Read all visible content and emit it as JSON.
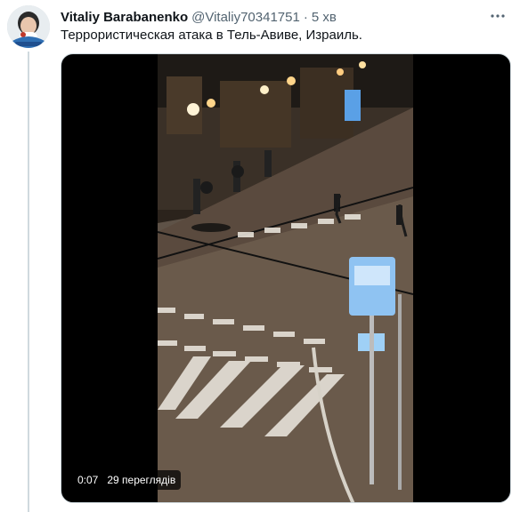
{
  "tweet": {
    "author_name": "Vitaliy Barabanenko",
    "handle": "@Vitaliy70341751",
    "separator": "·",
    "time": "5 хв",
    "text": "Террористическая атака в Тель-Авиве, Израиль.",
    "more_icon": "more-horizontal-icon"
  },
  "video": {
    "elapsed": "0:07",
    "views": "29 переглядів"
  },
  "colors": {
    "accent": "#1d9bf0",
    "text": "#0f1419",
    "secondary": "#536471"
  }
}
